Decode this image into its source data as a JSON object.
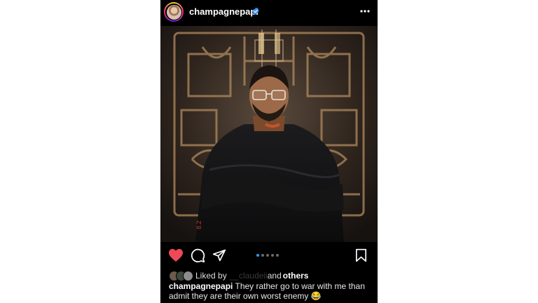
{
  "post": {
    "username": "champagnepapi",
    "verified": true,
    "liked_by_prefix": "Liked by",
    "liked_by_user": "__claudeii",
    "liked_by_suffix": "and",
    "liked_by_others": "others",
    "caption_user": "champagnepapi",
    "caption_text": "They rather go to war with me than admit they are their own worst enemy 😂",
    "carousel": {
      "total": 5,
      "active_index": 0
    },
    "liked": true
  },
  "icons": {
    "verified": "verified-badge-icon",
    "more": "more-dots-icon",
    "like": "heart-icon",
    "comment": "comment-icon",
    "share": "send-icon",
    "save": "bookmark-icon"
  },
  "colors": {
    "background": "#000000",
    "like_red": "#ed4956",
    "verified_blue": "#3897f0",
    "active_dot": "#3897f0"
  }
}
